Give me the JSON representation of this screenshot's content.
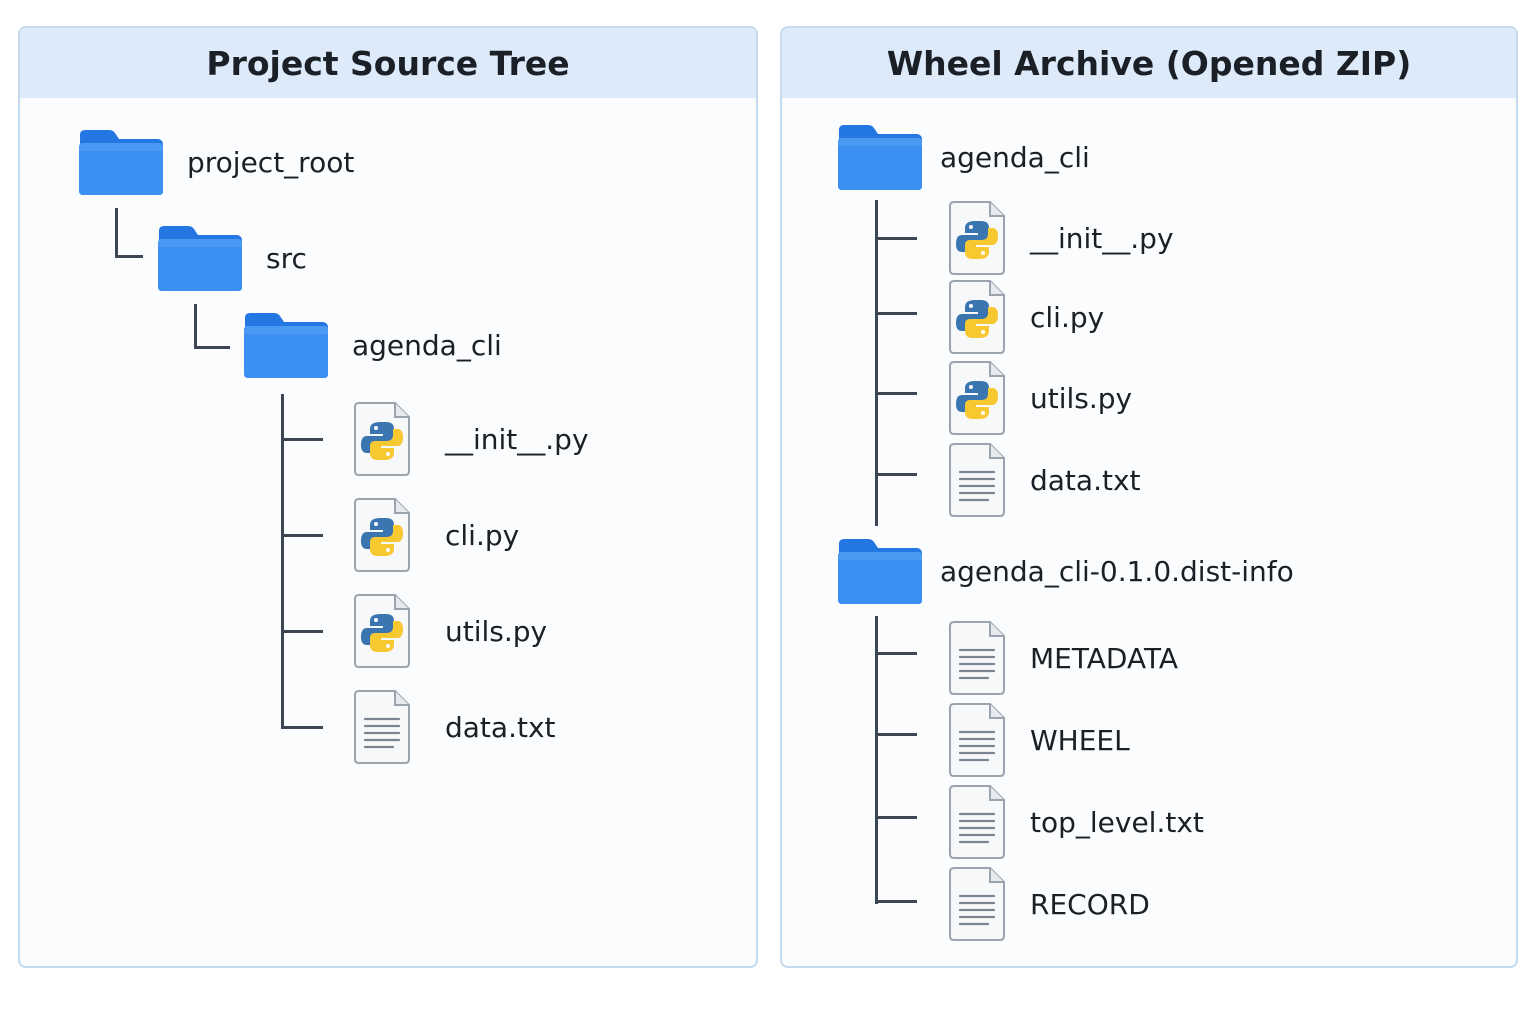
{
  "left_panel": {
    "title": "Project Source Tree",
    "root": {
      "label": "project_root",
      "icon": "folder-icon"
    },
    "src": {
      "label": "src",
      "icon": "folder-icon"
    },
    "package": {
      "label": "agenda_cli",
      "icon": "folder-icon"
    },
    "files": [
      {
        "label": "__init__.py",
        "icon": "python-file-icon"
      },
      {
        "label": "cli.py",
        "icon": "python-file-icon"
      },
      {
        "label": "utils.py",
        "icon": "python-file-icon"
      },
      {
        "label": "data.txt",
        "icon": "text-file-icon"
      }
    ]
  },
  "right_panel": {
    "title": "Wheel Archive (Opened ZIP)",
    "package": {
      "label": "agenda_cli",
      "icon": "folder-icon"
    },
    "package_files": [
      {
        "label": "__init__.py",
        "icon": "python-file-icon"
      },
      {
        "label": "cli.py",
        "icon": "python-file-icon"
      },
      {
        "label": "utils.py",
        "icon": "python-file-icon"
      },
      {
        "label": "data.txt",
        "icon": "text-file-icon"
      }
    ],
    "dist_info": {
      "label": "agenda_cli-0.1.0.dist-info",
      "icon": "folder-icon"
    },
    "dist_info_files": [
      {
        "label": "METADATA",
        "icon": "text-file-icon"
      },
      {
        "label": "WHEEL",
        "icon": "text-file-icon"
      },
      {
        "label": "top_level.txt",
        "icon": "text-file-icon"
      },
      {
        "label": "RECORD",
        "icon": "text-file-icon"
      }
    ]
  },
  "colors": {
    "folder": "#3a8ff0",
    "folder_tab": "#2477e3",
    "tree_line": "#3d4654",
    "header_bg": "#dceafa",
    "panel_border": "#c5d9ef",
    "python_blue": "#3a75b0",
    "python_yellow": "#f7c830"
  }
}
